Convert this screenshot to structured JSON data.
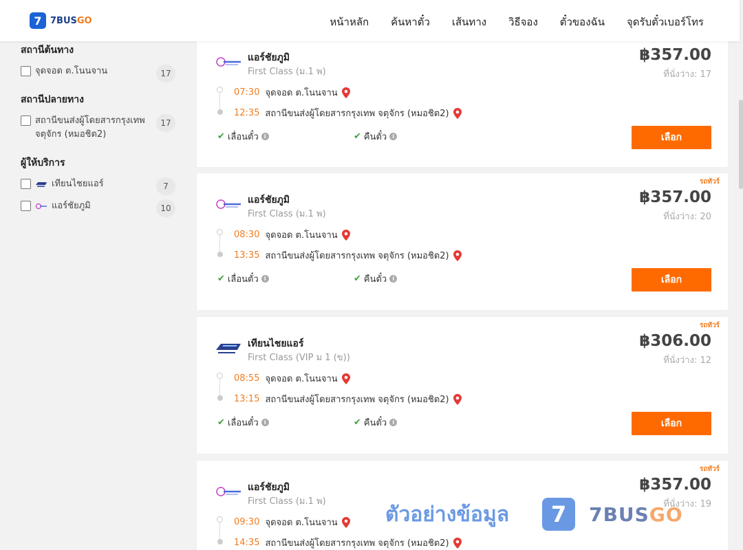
{
  "header": {
    "logo_text": "7BUS",
    "logo_text_go": "GO",
    "logo_mark": "7",
    "nav": [
      "หน้าหลัก",
      "ค้นหาตั๋ว",
      "เส้นทาง",
      "วิธีจอง",
      "ตั๋วของฉัน",
      "จุดรับตั๋วเบอร์โทร"
    ]
  },
  "filters": {
    "origin": {
      "title": "สถานีต้นทาง",
      "items": [
        {
          "label": "จุดจอด ต.โนนจาน",
          "count": "17"
        }
      ]
    },
    "destination": {
      "title": "สถานีปลายทาง",
      "items": [
        {
          "label": "สถานีขนส่งผู้โดยสารกรุงเทพ จตุจักร (หมอชิต2)",
          "count": "17"
        }
      ]
    },
    "operator": {
      "title": "ผู้ให้บริการ",
      "items": [
        {
          "label": "เทียนไชยแอร์",
          "count": "7"
        },
        {
          "label": "แอร์ชัยภูมิ",
          "count": "10"
        }
      ]
    }
  },
  "trips": [
    {
      "badge": "",
      "operator": "แอร์ชัยภูมิ",
      "class": "First Class (ม.1 พ)",
      "price": "฿357.00",
      "seats": "ที่นั่งว่าง: 17",
      "dep_time": "07:30",
      "dep_stop": "จุดจอด ต.โนนจาน",
      "arr_time": "12:35",
      "arr_stop": "สถานีขนส่งผู้โดยสารกรุงเทพ จตุจักร (หมอชิต2)",
      "policy_move": "เลื่อนตั๋ว",
      "policy_refund": "คืนตั๋ว",
      "button": "เลือก"
    },
    {
      "badge": "รถทัวร์",
      "operator": "แอร์ชัยภูมิ",
      "class": "First Class (ม.1 พ)",
      "price": "฿357.00",
      "seats": "ที่นั่งว่าง: 20",
      "dep_time": "08:30",
      "dep_stop": "จุดจอด ต.โนนจาน",
      "arr_time": "13:35",
      "arr_stop": "สถานีขนส่งผู้โดยสารกรุงเทพ จตุจักร (หมอชิต2)",
      "policy_move": "เลื่อนตั๋ว",
      "policy_refund": "คืนตั๋ว",
      "button": "เลือก"
    },
    {
      "badge": "รถทัวร์",
      "operator": "เทียนไชยแอร์",
      "class": "First Class (VIP ม 1 (ข))",
      "price": "฿306.00",
      "seats": "ที่นั่งว่าง: 12",
      "dep_time": "08:55",
      "dep_stop": "จุดจอด ต.โนนจาน",
      "arr_time": "13:15",
      "arr_stop": "สถานีขนส่งผู้โดยสารกรุงเทพ จตุจักร (หมอชิต2)",
      "policy_move": "เลื่อนตั๋ว",
      "policy_refund": "คืนตั๋ว",
      "button": "เลือก"
    },
    {
      "badge": "รถทัวร์",
      "operator": "แอร์ชัยภูมิ",
      "class": "First Class (ม.1 พ)",
      "price": "฿357.00",
      "seats": "ที่นั่งว่าง: 19",
      "dep_time": "09:30",
      "dep_stop": "จุดจอด ต.โนนจาน",
      "arr_time": "14:35",
      "arr_stop": "สถานีขนส่งผู้โดยสารกรุงเทพ จตุจักร (หมอชิต2)",
      "policy_move": "",
      "policy_refund": "",
      "button": ""
    }
  ],
  "watermark": {
    "text": "ตัวอย่างข้อมูล",
    "brand": "7BUS",
    "brand_go": "GO",
    "mark": "7"
  },
  "colors": {
    "accent": "#ff6a00",
    "time": "#f27b1d",
    "brand_blue": "#1b63d6",
    "pin": "#e53935",
    "check": "#3aa33a"
  }
}
